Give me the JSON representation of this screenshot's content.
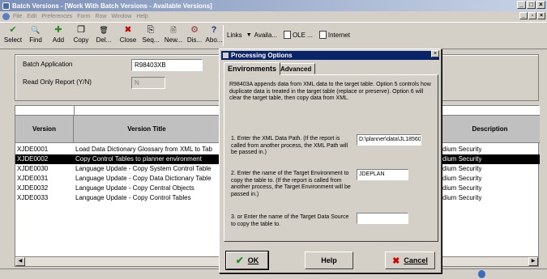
{
  "window": {
    "title": "Batch Versions - [Work With Batch Versions - Available Versions]"
  },
  "menu": [
    "File",
    "Edit",
    "Preferences",
    "Form",
    "Row",
    "Window",
    "Help"
  ],
  "toolbar": [
    {
      "label": "Select",
      "icon": "checkmark-icon",
      "glyph": "✔"
    },
    {
      "label": "Find",
      "icon": "find-icon",
      "glyph": "🔍"
    },
    {
      "label": "Add",
      "icon": "add-icon",
      "glyph": "✚"
    },
    {
      "label": "Copy",
      "icon": "copy-icon",
      "glyph": "❐"
    },
    {
      "label": "Del...",
      "icon": "delete-icon",
      "glyph": "🗑"
    },
    {
      "label": "Close",
      "icon": "close-icon",
      "glyph": "✖"
    },
    {
      "label": "Seq...",
      "icon": "sequence-icon",
      "glyph": "⎘"
    },
    {
      "label": "New...",
      "icon": "new-icon",
      "glyph": "🗎"
    },
    {
      "label": "Dis...",
      "icon": "display-icon",
      "glyph": "⚙"
    },
    {
      "label": "Abo...",
      "icon": "about-icon",
      "glyph": "?"
    }
  ],
  "links": {
    "label": "Links",
    "item1": "Availa...",
    "item2": "OLE ...",
    "item3": "Internet"
  },
  "header": {
    "batch_application_label": "Batch Application",
    "batch_application_value": "R98403XB",
    "read_only_label": "Read Only Report (Y/N)",
    "read_only_value": "N"
  },
  "grid": {
    "columns": {
      "version": "Version",
      "title": "Version Title",
      "description": "Description"
    },
    "rows": [
      {
        "version": "XJDE0001",
        "title": "Load Data Dictionary Glossary from XML to Tab",
        "desc": "dium Security",
        "selected": false
      },
      {
        "version": "XJDE0002",
        "title": "Copy Control Tables to planner environment",
        "desc": "dium Security",
        "selected": true
      },
      {
        "version": "XJDE0030",
        "title": "Language Update - Copy System Control Table",
        "desc": "dium Security",
        "selected": false
      },
      {
        "version": "XJDE0031",
        "title": "Language Update - Copy Data Dictionary Table",
        "desc": "dium Security",
        "selected": false
      },
      {
        "version": "XJDE0032",
        "title": "Language Update - Copy Central Objects",
        "desc": "dium Security",
        "selected": false
      },
      {
        "version": "XJDE0033",
        "title": "Language Update - Copy Control Tables",
        "desc": "dium Security",
        "selected": false
      }
    ]
  },
  "dialog": {
    "title": "Processing Options",
    "tabs": {
      "environments": "Environments",
      "advanced": "Advanced"
    },
    "intro": "R98403A appends data from XML data to the target table. Option 5 controls how duplicate data is treated in the target table (replace or preserve). Option 6 will clear the target table, then copy data from XML.",
    "opt1": {
      "text": "1. Enter the XML Data Path. (If the report is called from another process, the XML Path will be passed in.)",
      "value": "D:\\planner\\data\\JL18560"
    },
    "opt2": {
      "text": "2. Enter the name of the Target Environment to copy the table to. (If the report is called from another process, the Target Environment will be passed in.)",
      "value": "JDEPLAN"
    },
    "opt3": {
      "text": "3. or Enter the name of the Target Data Source to copy the table to.",
      "value": ""
    },
    "buttons": {
      "ok": "OK",
      "help": "Help",
      "cancel": "Cancel"
    }
  },
  "colors": {
    "selected_row": "#000000",
    "dialog_title": "#0a246a",
    "window_chrome": "#d4d0c8"
  }
}
